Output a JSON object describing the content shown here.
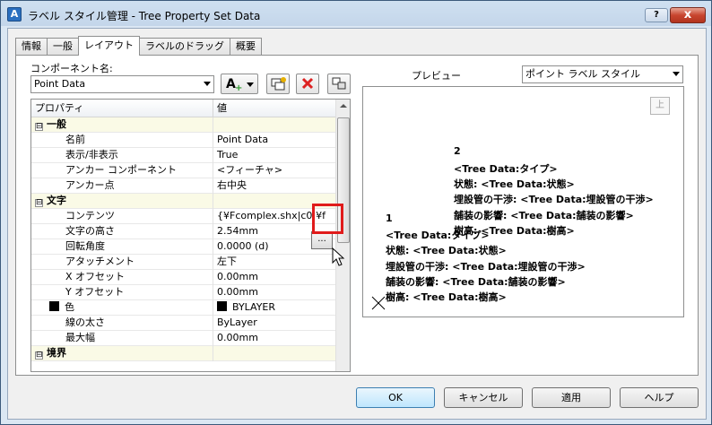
{
  "window": {
    "title": "ラベル スタイル管理 - Tree Property Set Data",
    "help_label": "?",
    "close_label": "x",
    "app_icon_letter": "A"
  },
  "tabs": [
    {
      "label": "情報"
    },
    {
      "label": "一般"
    },
    {
      "label": "レイアウト"
    },
    {
      "label": "ラベルのドラッグ"
    },
    {
      "label": "概要"
    }
  ],
  "component": {
    "label": "コンポーネント名:",
    "selected": "Point Data"
  },
  "grid": {
    "headers": [
      "プロパティ",
      "値"
    ],
    "rows": [
      {
        "type": "cat",
        "expander": "⊟",
        "name": "一般",
        "value": ""
      },
      {
        "type": "prop",
        "name": "名前",
        "value": "Point Data"
      },
      {
        "type": "prop",
        "name": "表示/非表示",
        "value": "True"
      },
      {
        "type": "prop",
        "name": "アンカー コンポーネント",
        "value": "<フィーチャ>"
      },
      {
        "type": "prop",
        "name": "アンカー点",
        "value": "右中央"
      },
      {
        "type": "cat",
        "expander": "⊟",
        "name": "文字",
        "value": ""
      },
      {
        "type": "prop",
        "name": "コンテンツ",
        "value": "{¥Fcomplex.shx|c0;¥f"
      },
      {
        "type": "prop",
        "name": "文字の高さ",
        "value": "2.54mm"
      },
      {
        "type": "prop",
        "name": "回転角度",
        "value": "0.0000 (d)"
      },
      {
        "type": "prop",
        "name": "アタッチメント",
        "value": "左下"
      },
      {
        "type": "prop",
        "name": "X オフセット",
        "value": "0.00mm"
      },
      {
        "type": "prop",
        "name": "Y オフセット",
        "value": "0.00mm"
      },
      {
        "type": "prop",
        "name": "色",
        "value": "BYLAYER",
        "swatch": true
      },
      {
        "type": "prop",
        "name": "線の太さ",
        "value": "ByLayer"
      },
      {
        "type": "prop",
        "name": "最大幅",
        "value": "0.00mm"
      },
      {
        "type": "cat",
        "expander": "⊟",
        "name": "境界",
        "value": ""
      }
    ],
    "ellipsis_label": "..."
  },
  "preview": {
    "label": "プレビュー",
    "style_selected": "ポイント ラベル スタイル",
    "up_label": "上",
    "label2": {
      "number": "2",
      "lines": [
        "<Tree Data:タイプ>",
        "状態:  <Tree Data:状態>",
        "埋設管の干渉:  <Tree Data:埋設管の干渉>",
        "舗装の影響:  <Tree Data:舗装の影響>",
        "樹高:  <Tree Data:樹高>"
      ]
    },
    "label1": {
      "number": "1",
      "lines": [
        "<Tree Data:タイプ>",
        "状態:  <Tree Data:状態>",
        "埋設管の干渉:  <Tree Data:埋設管の干渉>",
        "舗装の影響:  <Tree Data:舗装の影響>",
        "樹高:  <Tree Data:樹高>"
      ]
    }
  },
  "buttons": {
    "ok": "OK",
    "cancel": "キャンセル",
    "apply": "適用",
    "help": "ヘルプ"
  }
}
